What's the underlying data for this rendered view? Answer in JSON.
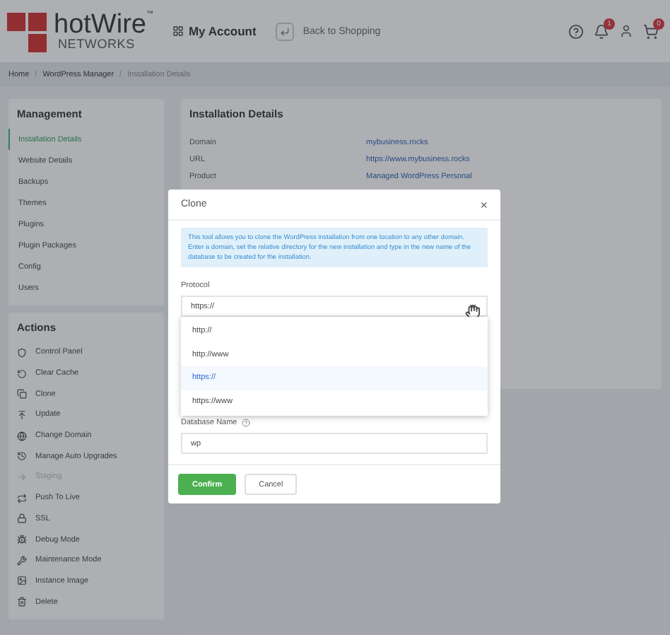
{
  "header": {
    "logo_top": "hotWire",
    "logo_mark": "™",
    "logo_bottom": "NETWORKS",
    "account": "My Account",
    "back": "Back to Shopping",
    "notifications": "1",
    "cart": "0"
  },
  "breadcrumb": [
    {
      "kind": "link",
      "label": "Home",
      "current": false
    },
    {
      "kind": "separator",
      "label": "/"
    },
    {
      "kind": "link",
      "label": "WordPress Manager",
      "current": false
    },
    {
      "kind": "separator",
      "label": "/"
    },
    {
      "kind": "link",
      "label": "Installation Details",
      "current": true
    }
  ],
  "management": {
    "title": "Management",
    "items": [
      {
        "label": "Installation Details",
        "selected": true
      },
      {
        "label": "Website Details",
        "selected": false
      },
      {
        "label": "Backups",
        "selected": false
      },
      {
        "label": "Themes",
        "selected": false
      },
      {
        "label": "Plugins",
        "selected": false
      },
      {
        "label": "Plugin Packages",
        "selected": false
      },
      {
        "label": "Config",
        "selected": false
      },
      {
        "label": "Users",
        "selected": false
      }
    ]
  },
  "actions": {
    "title": "Actions",
    "items": [
      {
        "label": "Control Panel",
        "disabled": false
      },
      {
        "label": "Clear Cache",
        "disabled": false
      },
      {
        "label": "Clone",
        "disabled": false
      },
      {
        "label": "Update",
        "disabled": false
      },
      {
        "label": "Change Domain",
        "disabled": false
      },
      {
        "label": "Manage Auto Upgrades",
        "disabled": false
      },
      {
        "label": "Staging",
        "disabled": true
      },
      {
        "label": "Push To Live",
        "disabled": false
      },
      {
        "label": "SSL",
        "disabled": false
      },
      {
        "label": "Debug Mode",
        "disabled": false
      },
      {
        "label": "Maintenance Mode",
        "disabled": false
      },
      {
        "label": "Instance Image",
        "disabled": false
      },
      {
        "label": "Delete",
        "disabled": false
      }
    ]
  },
  "details": {
    "title": "Installation Details",
    "rows": [
      {
        "label": "Domain",
        "value": "mybusiness.rocks"
      },
      {
        "label": "URL",
        "value": "https://www.mybusiness.rocks"
      },
      {
        "label": "Product",
        "value": "Managed WordPress Personal"
      }
    ]
  },
  "modal": {
    "title": "Clone",
    "close": "×",
    "info": "This tool allows you to clone the WordPress installation from one location to any other domain. Enter a domain, set the relative directory for the new installation and type in the new name of the database to be created for the installation.",
    "protocol_label": "Protocol",
    "protocol_value": "https://",
    "options": [
      {
        "label": "http://",
        "selected": false
      },
      {
        "label": "http://www",
        "selected": false
      },
      {
        "label": "https://",
        "selected": true
      },
      {
        "label": "https://www",
        "selected": false
      }
    ],
    "db_label": "Database Name",
    "db_value": "wp",
    "confirm": "Confirm",
    "cancel": "Cancel"
  }
}
